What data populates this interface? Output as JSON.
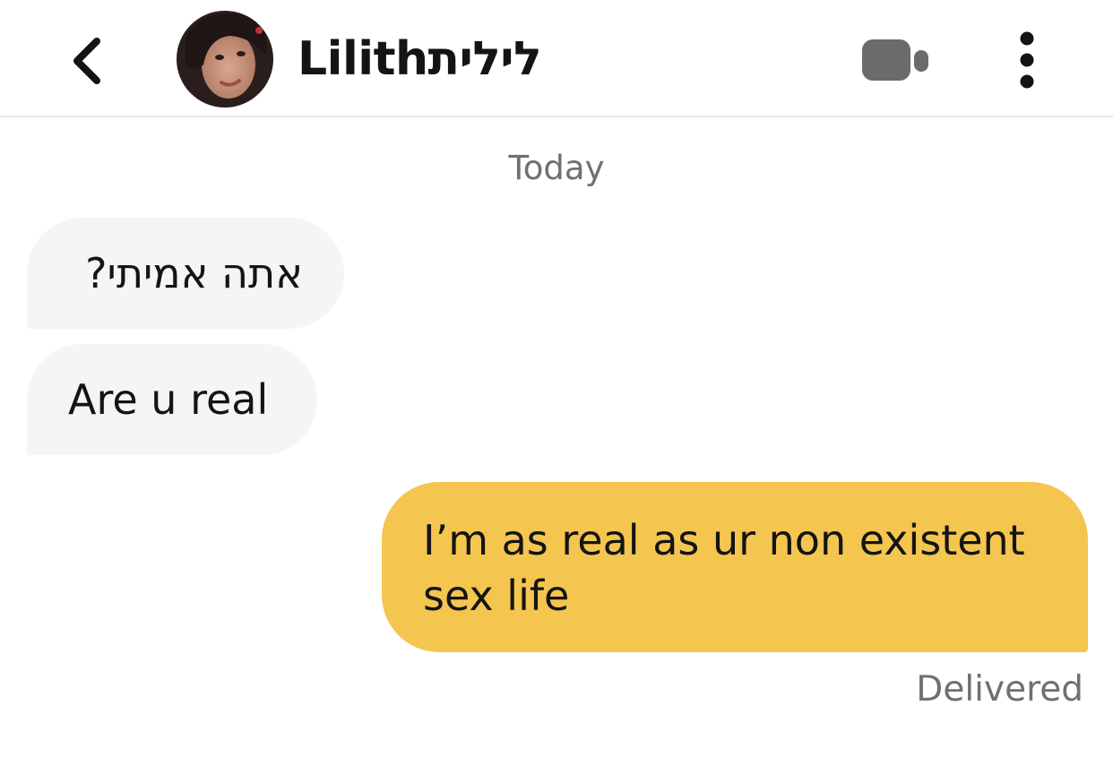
{
  "header": {
    "back_icon": "chevron-left-icon",
    "contact_name": "Lilithלילית",
    "video_icon": "video-camera-icon",
    "more_icon": "more-vertical-icon"
  },
  "conversation": {
    "date_label": "Today",
    "messages": [
      {
        "direction": "incoming",
        "text": "אתה אמיתי?"
      },
      {
        "direction": "incoming",
        "text": "Are u real"
      },
      {
        "direction": "outgoing",
        "text": "I’m as real as ur non existent sex life"
      }
    ],
    "status": "Delivered"
  },
  "colors": {
    "incoming_bubble": "#f5f5f5",
    "outgoing_bubble": "#f4c64f",
    "secondary_text": "#707070",
    "icon_gray": "#6b6b6b"
  }
}
